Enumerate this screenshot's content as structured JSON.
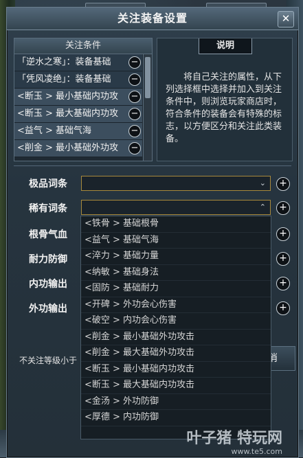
{
  "window": {
    "title": "关注装备设置",
    "close_glyph": "✕"
  },
  "conditions": {
    "header": "关注条件",
    "items": [
      "「逆水之寒」：装备基础",
      "「凭风凌绝」：装备基础",
      "<断玉 > 最小基础内功攻",
      "<断玉 > 最大基础内功攻",
      "<益气 > 基础气海",
      "<削金 > 最小基础外功攻"
    ]
  },
  "description": {
    "tab": "说明",
    "text": "将自己关注的属性，从下列选择框中选择并加入到关注条件中，则浏览玩家商店时，符合条件的装备会有特殊的标志，以方便区分和关注此类装备。"
  },
  "rows": [
    {
      "label": "极品词条"
    },
    {
      "label": "稀有词条"
    },
    {
      "label": "根骨气血"
    },
    {
      "label": "耐力防御"
    },
    {
      "label": "内功输出"
    },
    {
      "label": "外功输出"
    }
  ],
  "dropdown": {
    "options": [
      "<铁骨 > 基础根骨",
      "<益气 > 基础气海",
      "<淬力 > 基础力量",
      "<纳敏 > 基础身法",
      "<固防 > 基础耐力",
      "<开碑 > 外功会心伤害",
      "<破空 > 内功会心伤害",
      "<削金 > 最小基础外功攻击",
      "<削金 > 最大基础外功攻击",
      "<断玉 > 最小基础内功攻击",
      "<断玉 > 最大基础内功攻击",
      "<金汤 > 外功防御",
      "<厚德 > 内功防御"
    ]
  },
  "bottom": {
    "label": "不关注等级小于",
    "cancel": "取消"
  },
  "icons": {
    "minus": "−",
    "plus": "+",
    "caret_down": "⌄",
    "caret_up": "⌃"
  },
  "watermark": {
    "brand": "叶子猪 特玩网",
    "url": "www.te5.com"
  }
}
